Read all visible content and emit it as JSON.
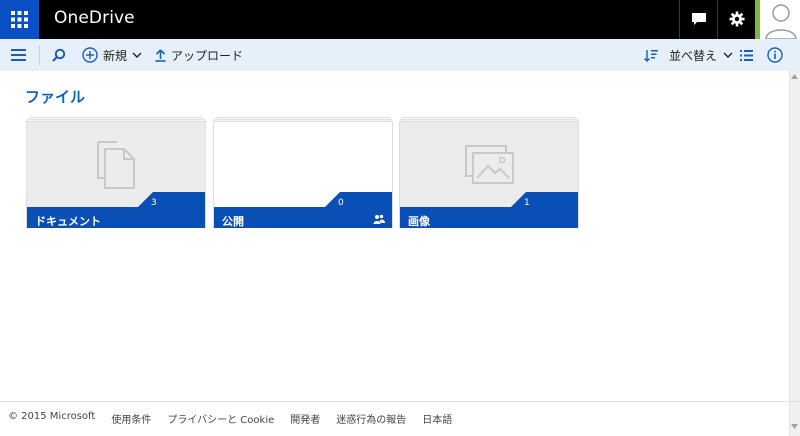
{
  "app": {
    "title": "OneDrive"
  },
  "commandbar": {
    "new_label": "新規",
    "upload_label": "アップロード",
    "sort_label": "並べ替え"
  },
  "section": {
    "title": "ファイル"
  },
  "tiles": [
    {
      "name": "ドキュメント",
      "count": "3",
      "icon": "documents-icon"
    },
    {
      "name": "公開",
      "count": "0",
      "icon": "shared-icon"
    },
    {
      "name": "画像",
      "count": "1",
      "icon": "pictures-icon"
    }
  ],
  "footer": {
    "copyright": "© 2015 Microsoft",
    "links": [
      "使用条件",
      "プライバシーと Cookie",
      "開発者",
      "迷惑行為の報告",
      "日本語"
    ]
  },
  "colors": {
    "brand": "#0a50c4",
    "tile_band": "#0a4fb5",
    "title_blue": "#0a63c1",
    "presence_green": "#7ab640"
  }
}
